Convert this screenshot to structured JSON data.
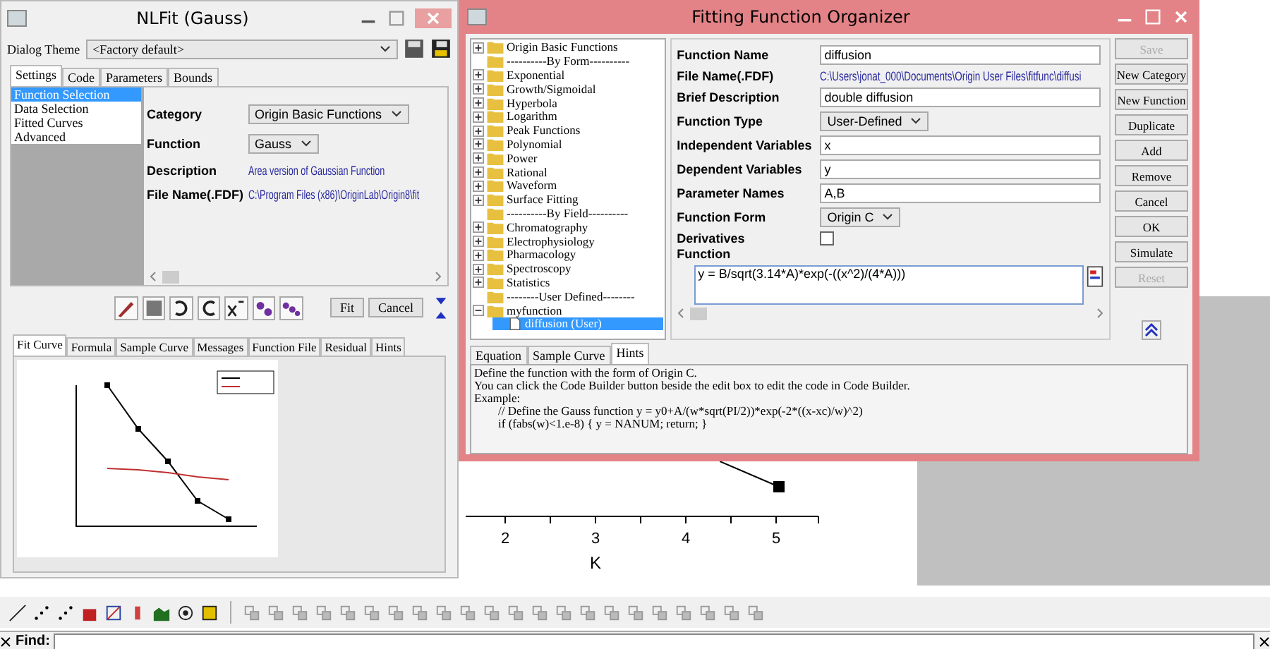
{
  "nlfit": {
    "title": "NLFit (Gauss)",
    "theme_label": "Dialog Theme",
    "theme_value": "<Factory default>",
    "tabs": [
      {
        "label": "Settings",
        "selected": true
      },
      {
        "label": "Code",
        "selected": false
      },
      {
        "label": "Parameters",
        "selected": false
      },
      {
        "label": "Bounds",
        "selected": false
      }
    ],
    "pages": [
      {
        "label": "Function Selection",
        "selected": true
      },
      {
        "label": "Data Selection",
        "selected": false
      },
      {
        "label": "Fitted Curves",
        "selected": false
      },
      {
        "label": "Advanced",
        "selected": false
      }
    ],
    "fields": [
      {
        "label": "Category",
        "kind": "dropdown",
        "value": "Origin Basic Functions"
      },
      {
        "label": "Function",
        "kind": "dropdown",
        "value": "Gauss"
      },
      {
        "label": "Description",
        "kind": "link",
        "value": "Area version of Gaussian Function"
      },
      {
        "label": "File Name(.FDF)",
        "kind": "link",
        "value": "C:\\Program Files (x86)\\OriginLab\\Origin8\\fit"
      }
    ],
    "buttons": [
      "Fit",
      "Cancel"
    ],
    "bottom_tabs": [
      {
        "label": "Fit Curve",
        "selected": true
      },
      {
        "label": "Formula",
        "selected": false
      },
      {
        "label": "Sample Curve",
        "selected": false
      },
      {
        "label": "Messages",
        "selected": false
      },
      {
        "label": "Function File",
        "selected": false
      },
      {
        "label": "Residual",
        "selected": false
      },
      {
        "label": "Hints",
        "selected": false
      }
    ]
  },
  "organizer": {
    "title": "Fitting Function Organizer",
    "tree": [
      {
        "label": "Origin Basic Functions",
        "kind": "category",
        "expanded": false
      },
      {
        "label": "----------By Form----------",
        "kind": "separator"
      },
      {
        "label": "Exponential",
        "kind": "category",
        "expanded": false
      },
      {
        "label": "Growth/Sigmoidal",
        "kind": "category",
        "expanded": false
      },
      {
        "label": "Hyperbola",
        "kind": "category",
        "expanded": false
      },
      {
        "label": "Logarithm",
        "kind": "category",
        "expanded": false
      },
      {
        "label": "Peak Functions",
        "kind": "category",
        "expanded": false
      },
      {
        "label": "Polynomial",
        "kind": "category",
        "expanded": false
      },
      {
        "label": "Power",
        "kind": "category",
        "expanded": false
      },
      {
        "label": "Rational",
        "kind": "category",
        "expanded": false
      },
      {
        "label": "Waveform",
        "kind": "category",
        "expanded": false
      },
      {
        "label": "Surface Fitting",
        "kind": "category",
        "expanded": false
      },
      {
        "label": "----------By Field----------",
        "kind": "separator"
      },
      {
        "label": "Chromatography",
        "kind": "category",
        "expanded": false
      },
      {
        "label": "Electrophysiology",
        "kind": "category",
        "expanded": false
      },
      {
        "label": "Pharmacology",
        "kind": "category",
        "expanded": false
      },
      {
        "label": "Spectroscopy",
        "kind": "category",
        "expanded": false
      },
      {
        "label": "Statistics",
        "kind": "category",
        "expanded": false
      },
      {
        "label": "--------User Defined--------",
        "kind": "separator"
      },
      {
        "label": "myfunction",
        "kind": "category",
        "expanded": true,
        "children": [
          {
            "label": "diffusion (User)",
            "selected": true
          }
        ]
      }
    ],
    "fields": [
      {
        "label": "Function Name",
        "kind": "text",
        "value": "diffusion"
      },
      {
        "label": "File Name(.FDF)",
        "kind": "link",
        "value": "C:\\Users\\jonat_000\\Documents\\Origin User Files\\fitfunc\\diffusi"
      },
      {
        "label": "Brief Description",
        "kind": "text",
        "value": "double diffusion"
      },
      {
        "label": "Function Type",
        "kind": "dropdown",
        "value": "User-Defined"
      },
      {
        "label": "Independent Variables",
        "kind": "text",
        "value": "x"
      },
      {
        "label": "Dependent Variables",
        "kind": "text",
        "value": "y"
      },
      {
        "label": "Parameter Names",
        "kind": "text",
        "value": "A,B"
      },
      {
        "label": "Function Form",
        "kind": "dropdown",
        "value": "Origin C"
      },
      {
        "label": "Derivatives",
        "kind": "checkbox",
        "checked": false
      }
    ],
    "function_label": "Function",
    "function_code": "y = B/sqrt(3.14*A)*exp(-((x^2)/(4*A)))",
    "buttons": [
      {
        "label": "Save",
        "disabled": true
      },
      {
        "label": "New Category",
        "disabled": false
      },
      {
        "label": "New Function",
        "disabled": false
      },
      {
        "label": "Duplicate",
        "disabled": false
      },
      {
        "label": "Add",
        "disabled": false
      },
      {
        "label": "Remove",
        "disabled": false
      },
      {
        "label": "Cancel",
        "disabled": false
      },
      {
        "label": "OK",
        "disabled": false
      },
      {
        "label": "Simulate",
        "disabled": false
      },
      {
        "label": "Reset",
        "disabled": true
      }
    ],
    "bottom_tabs": [
      {
        "label": "Equation",
        "selected": false
      },
      {
        "label": "Sample Curve",
        "selected": false
      },
      {
        "label": "Hints",
        "selected": true
      }
    ],
    "hints": [
      "Define the function with the form of Origin C.",
      "You can click the Code Builder button beside the edit box to edit the code in Code Builder.",
      "Example:",
      "        // Define the Gauss function y = y0+A/(w*sqrt(PI/2))*exp(-2*((x-xc)/w)^2)",
      "        if (fabs(w)<1.e-8) { y = NANUM; return; }"
    ]
  },
  "graph": {
    "x_ticks": [
      "2",
      "3",
      "4",
      "5"
    ],
    "x_label": "K"
  },
  "find_bar": {
    "label": "Find:"
  }
}
